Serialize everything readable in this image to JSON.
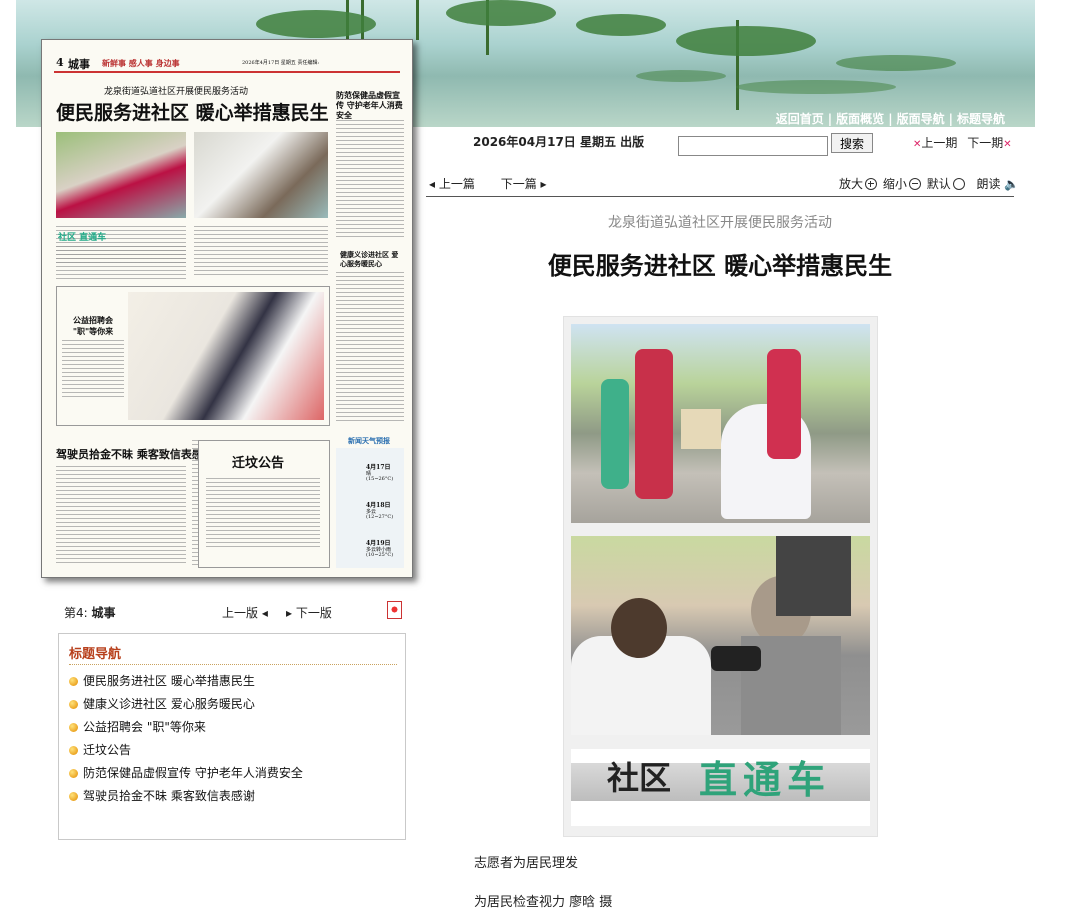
{
  "topnav": {
    "items": [
      "返回首页",
      "版面概览",
      "版面导航",
      "标题导航"
    ],
    "sep": "|"
  },
  "paper": {
    "page_no": "4",
    "section": "城事",
    "slogan": "新鲜事 感人事 身边事",
    "masthead_date": "2026年4月17日 星期五 责任编辑:",
    "sub_headline": "龙泉街道弘道社区开展便民服务活动",
    "main_headline": "便民服务进社区 暖心举措惠民生",
    "side_headline": "防范保健品虚假宣传 守护老年人消费安全",
    "column_label": "社区 直通车",
    "ad_headline": "公益招聘会 \"职\"等你来",
    "health_headline": "健康义诊进社区 爱心服务暖民心",
    "driver_headline": "驾驶员拾金不昧 乘客致信表感谢",
    "notice_headline": "迁坟公告",
    "weather_label": "新闻天气预报",
    "weather": [
      {
        "date": "4月17日",
        "desc": "晴",
        "temp": "(15~26°C)"
      },
      {
        "date": "4月18日",
        "desc": "多云",
        "temp": "(12~27°C)"
      },
      {
        "date": "4月19日",
        "desc": "多云转小雨",
        "temp": "(10~25°C)"
      }
    ]
  },
  "pagebar": {
    "label": "第4:",
    "section": "城事",
    "prev": "上一版",
    "next": "下一版"
  },
  "titlenav": {
    "heading": "标题导航",
    "items": [
      "便民服务进社区 暖心举措惠民生",
      "健康义诊进社区 爱心服务暖民心",
      "公益招聘会 \"职\"等你来",
      "迁坟公告",
      "防范保健品虚假宣传 守护老年人消费安全",
      "驾驶员拾金不昧 乘客致信表感谢"
    ]
  },
  "header": {
    "date": "2026年04月17日 星期五 出版",
    "search_button": "搜索",
    "prev_issue": "上一期",
    "next_issue": "下一期"
  },
  "article_nav": {
    "prev": "上一篇",
    "next": "下一篇"
  },
  "zoom": {
    "enlarge": "放大",
    "shrink": "缩小",
    "default": "默认",
    "read": "朗读"
  },
  "article": {
    "subtitle": "龙泉街道弘道社区开展便民服务活动",
    "title": "便民服务进社区 暖心举措惠民生",
    "banner_text_1": "社区",
    "banner_text_2": "直通车",
    "caption1": "志愿者为居民理发",
    "caption2": "为居民检查视力 廖晗 摄"
  },
  "colors": {
    "accent": "#b8401c",
    "banner_green": "#2fa37a"
  }
}
